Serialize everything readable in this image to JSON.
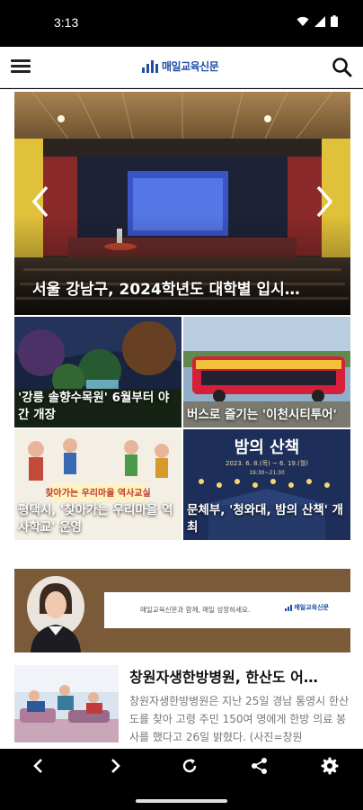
{
  "status_bar": {
    "time": "3:13",
    "icons": [
      "wifi-icon",
      "signal-icon",
      "battery-icon"
    ]
  },
  "header": {
    "logo_text": "매일교육신문",
    "menu_icon": "hamburger-menu-icon",
    "search_icon": "search-icon",
    "brand_color": "#1e4fa3"
  },
  "hero": {
    "title": "서울 강남구, 2024학년도 대학별 입시…",
    "prev_icon": "chevron-left-icon",
    "next_icon": "chevron-right-icon"
  },
  "tiles": [
    {
      "caption": "'강릉 솔향수목원' 6월부터 야간 개장"
    },
    {
      "caption": "버스로 즐기는 '이천시티투어'"
    },
    {
      "caption": "평택시, '찾아가는 우리마을 역사학교' 운영",
      "image_text": "찾아가는 우리마을 역사교실"
    },
    {
      "caption": "문체부, '청와대, 밤의 산책' 개최",
      "image_text": "밤의 산책",
      "image_subtext": "2023. 6. 8.(목) ~ 6. 19.(월)",
      "image_time": "19:30~21:30"
    }
  ],
  "banner": {
    "text": "매일교육신문과 함께, 매일 성장하세요.",
    "logo_text": "매일교육신문"
  },
  "article": {
    "title": "창원자생한방병원, 한산도 어…",
    "body": "창원자생한방병원은 지난 25일 경남 통영시 한산도를 찾아 고령 주민 150여 명에게 한방 의료 봉사를 했다고 26일 밝혔다. (사진=창원"
  },
  "nav_bar": {
    "icons": [
      "back-icon",
      "forward-icon",
      "reload-icon",
      "share-icon",
      "settings-icon"
    ]
  }
}
